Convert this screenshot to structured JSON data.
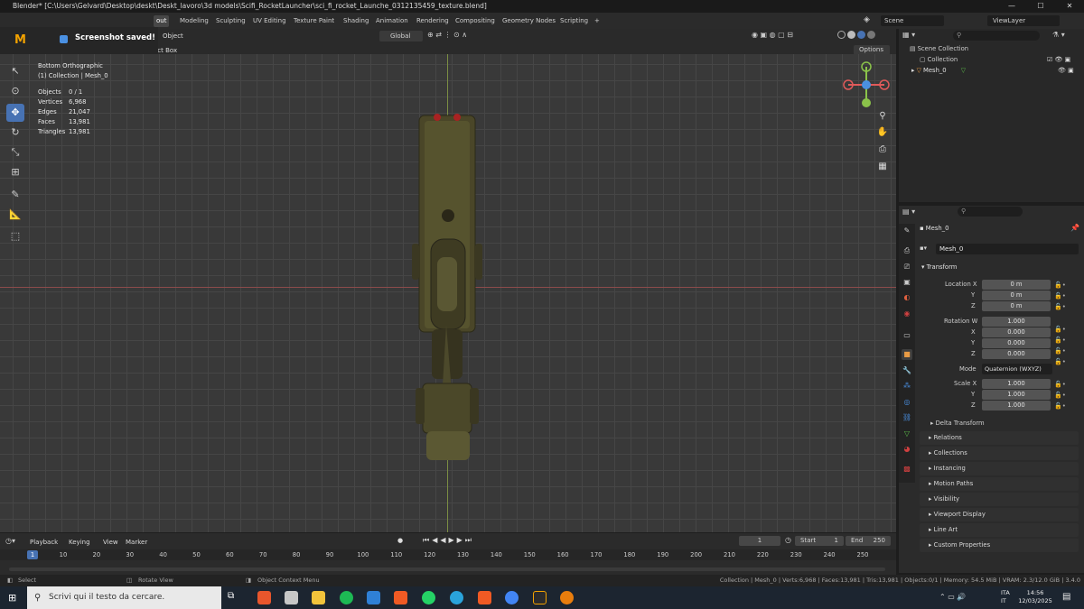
{
  "window": {
    "title": "Blender* [C:\\Users\\Gelvard\\Desktop\\deskt\\Deskt_lavoro\\3d models\\Scifi_RocketLauncher\\sci_fi_rocket_Launche_0312135459_texture.blend]",
    "minimize": "—",
    "maximize": "☐",
    "close": "✕"
  },
  "workspaces": [
    "out",
    "Modeling",
    "Sculpting",
    "UV Editing",
    "Texture Paint",
    "Shading",
    "Animation",
    "Rendering",
    "Compositing",
    "Geometry Nodes",
    "Scripting",
    "+"
  ],
  "scene": {
    "label": "Scene",
    "viewlayer": "ViewLayer"
  },
  "notification": {
    "text": "Screenshot saved!"
  },
  "viewport_header": {
    "object": "Object",
    "select_box": "ect Box",
    "orientation": "Global",
    "options": "Options"
  },
  "overlay": {
    "view_name": "Bottom Orthographic",
    "collection": "(1) Collection | Mesh_0",
    "stats": [
      {
        "k": "Objects",
        "v": "0 / 1"
      },
      {
        "k": "Vertices",
        "v": "6,968"
      },
      {
        "k": "Edges",
        "v": "21,047"
      },
      {
        "k": "Faces",
        "v": "13,981"
      },
      {
        "k": "Triangles",
        "v": "13,981"
      }
    ]
  },
  "gizmo": {
    "x": "X",
    "y": "Y",
    "z": "Z"
  },
  "outliner": {
    "root": "Scene Collection",
    "items": [
      "Collection",
      "Mesh_0"
    ]
  },
  "properties": {
    "object_name": "Mesh_0",
    "data_name": "Mesh_0",
    "transform": "Transform",
    "location_x_label": "Location X",
    "y_label": "Y",
    "z_label": "Z",
    "location": [
      "0 m",
      "0 m",
      "0 m"
    ],
    "rotation_w_label": "Rotation W",
    "x_label": "X",
    "rotation": [
      "1.000",
      "0.000",
      "0.000",
      "0.000"
    ],
    "mode_label": "Mode",
    "mode": "Quaternion (WXYZ)",
    "scale_x_label": "Scale X",
    "scale": [
      "1.000",
      "1.000",
      "1.000"
    ],
    "delta": "Delta Transform",
    "sections": [
      "Relations",
      "Collections",
      "Instancing",
      "Motion Paths",
      "Visibility",
      "Viewport Display",
      "Line Art",
      "Custom Properties"
    ]
  },
  "timeline": {
    "menus": [
      "Playback",
      "Keying",
      "View",
      "Marker"
    ],
    "current_frame": "1",
    "start_label": "Start",
    "start": "1",
    "end_label": "End",
    "end": "250",
    "ticks": [
      "1",
      "10",
      "20",
      "30",
      "40",
      "50",
      "60",
      "70",
      "80",
      "90",
      "100",
      "110",
      "120",
      "130",
      "140",
      "150",
      "160",
      "170",
      "180",
      "190",
      "200",
      "210",
      "220",
      "230",
      "240",
      "250"
    ]
  },
  "statusbar": {
    "select": "Select",
    "rotate": "Rotate View",
    "context": "Object Context Menu",
    "info": "Collection | Mesh_0 | Verts:6,968 | Faces:13,981 | Tris:13,981 | Objects:0/1 | Memory: 54.5 MiB | VRAM: 2.3/12.0 GiB | 3.4.0"
  },
  "taskbar": {
    "search_placeholder": "Scrivi qui il testo da cercare.",
    "lang1": "ITA",
    "lang2": "IT",
    "time": "14:56",
    "date": "12/03/2025"
  },
  "colors": {
    "accent": "#4772b3",
    "x_axis": "#e05a5a",
    "y_axis": "#8bc34a",
    "z_axis": "#4a90e2"
  }
}
